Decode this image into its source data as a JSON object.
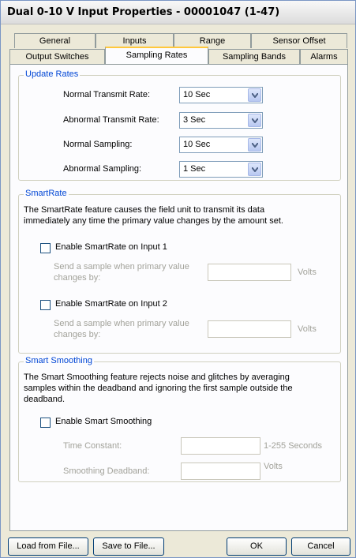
{
  "window": {
    "title": "Dual 0-10 V Input Properties - 00001047 (1-47)"
  },
  "tabs": {
    "row1": [
      {
        "label": "General"
      },
      {
        "label": "Inputs"
      },
      {
        "label": "Range"
      },
      {
        "label": "Sensor Offset"
      }
    ],
    "row2": [
      {
        "label": "Output Switches"
      },
      {
        "label": "Sampling Rates",
        "active": true
      },
      {
        "label": "Sampling Bands"
      },
      {
        "label": "Alarms"
      }
    ]
  },
  "update_rates": {
    "title": "Update Rates",
    "rows": [
      {
        "label": "Normal Transmit Rate:",
        "value": "10 Sec"
      },
      {
        "label": "Abnormal Transmit Rate:",
        "value": "3 Sec"
      },
      {
        "label": "Normal Sampling:",
        "value": "10 Sec"
      },
      {
        "label": "Abnormal Sampling:",
        "value": "1 Sec"
      }
    ]
  },
  "smartrate": {
    "title": "SmartRate",
    "description_line1": "The SmartRate feature causes the field unit to transmit its data",
    "description_line2": "immediately any time the primary value changes by the amount set.",
    "input1": {
      "checkbox_label": "Enable SmartRate on Input 1",
      "checked": false,
      "field_label_line1": "Send a sample when primary value",
      "field_label_line2": "changes by:",
      "value": "",
      "unit": "Volts"
    },
    "input2": {
      "checkbox_label": "Enable SmartRate on Input 2",
      "checked": false,
      "field_label_line1": "Send a sample when primary value",
      "field_label_line2": "changes by:",
      "value": "",
      "unit": "Volts"
    }
  },
  "smart_smoothing": {
    "title": "Smart Smoothing",
    "description_line1": "The Smart Smoothing feature rejects noise and glitches by averaging",
    "description_line2": "samples within the deadband and ignoring the first sample outside the",
    "description_line3": "deadband.",
    "checkbox_label": "Enable Smart Smoothing",
    "checked": false,
    "time_constant_label": "Time Constant:",
    "time_constant_value": "",
    "time_constant_unit": "1-255 Seconds",
    "deadband_label": "Smoothing Deadband:",
    "deadband_value": "",
    "deadband_unit": "Volts"
  },
  "buttons": {
    "load": "Load from File...",
    "save": "Save to File...",
    "ok": "OK",
    "cancel": "Cancel"
  }
}
